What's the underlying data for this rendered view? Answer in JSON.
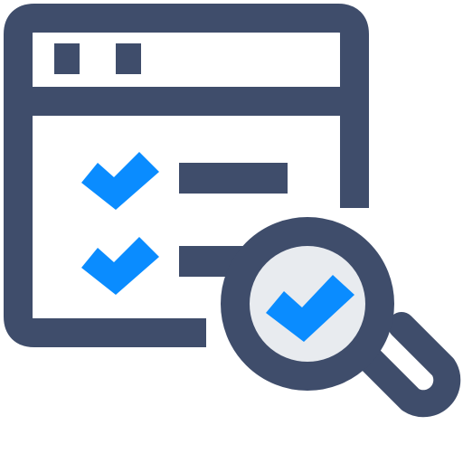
{
  "icon": {
    "name": "checklist-audit-icon",
    "colors": {
      "outline": "#3f4d6b",
      "accent": "#0a8cff",
      "lens_fill": "#e8ebef",
      "background": "#ffffff"
    }
  }
}
